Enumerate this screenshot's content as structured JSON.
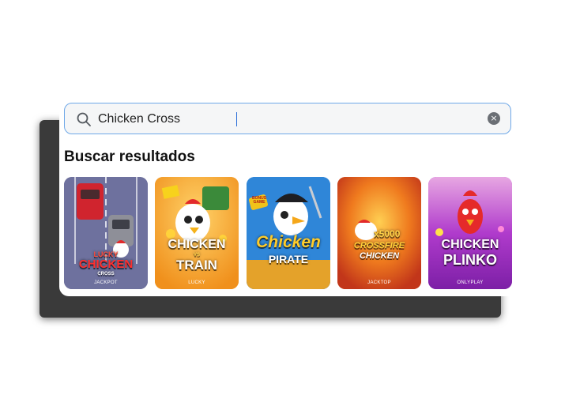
{
  "search": {
    "value": "Chicken Cross",
    "placeholder": "",
    "search_icon": "search-icon",
    "clear_icon": "clear-icon",
    "clear_glyph": "×"
  },
  "results": {
    "heading": "Buscar resultados",
    "games": [
      {
        "title_lines": [
          "LUCKY",
          "CHICKEN",
          "CROSS"
        ],
        "provider": "JACKPOT",
        "colors": {
          "bg": "#6b6fa0",
          "title": "#ff3a3a"
        }
      },
      {
        "title_lines": [
          "CHICKEN",
          "VS",
          "TRAIN"
        ],
        "provider": "LUCKY",
        "colors": {
          "bg": "#f6a623",
          "title": "#ffffff"
        }
      },
      {
        "title_lines": [
          "Chicken",
          "PIRATE"
        ],
        "extra": "BONUS GAME",
        "provider": "",
        "colors": {
          "bg": "#2f86d8",
          "title": "#ffcc2a"
        }
      },
      {
        "title_lines": [
          "x5000",
          "CROSSFIRE",
          "CHICKEN"
        ],
        "provider": "JACKTOP",
        "colors": {
          "bg": "#e0601e",
          "title": "#ffd34a"
        }
      },
      {
        "title_lines": [
          "CHICKEN",
          "PLINKO"
        ],
        "provider": "ONLYPLAY",
        "colors": {
          "bg": "#a52dc6",
          "title": "#ffffff"
        }
      }
    ]
  }
}
